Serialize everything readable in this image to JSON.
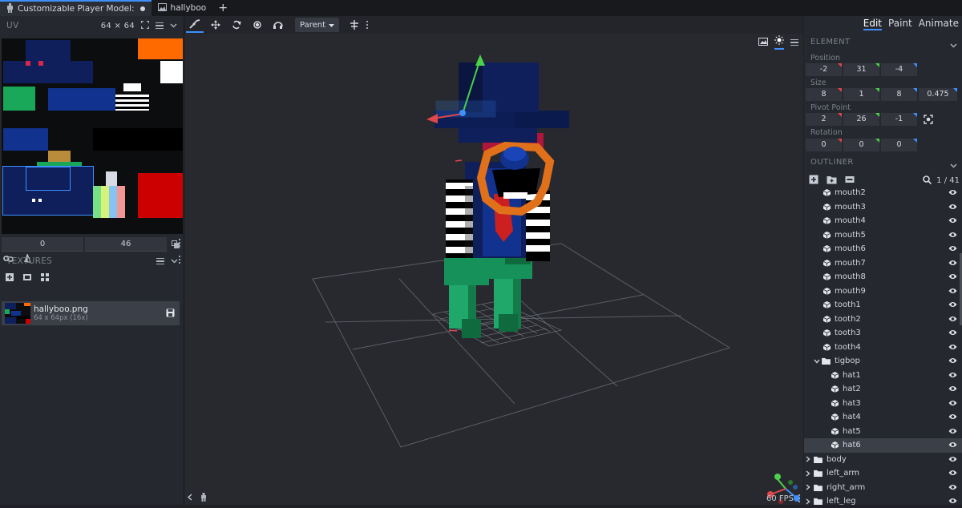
{
  "tabs": [
    {
      "label": "Customizable Player Model:",
      "active": true,
      "unsaved": true
    },
    {
      "label": "hallyboo",
      "active": false
    }
  ],
  "uv": {
    "title": "UV",
    "resolution": "64 ⨯ 64",
    "input_x": "0",
    "input_y": "46"
  },
  "textures": {
    "title": "TEXTURES",
    "item_name": "hallyboo.png",
    "item_size": "64 x 64px (16x)"
  },
  "toolbar": {
    "pivot_select": "Parent"
  },
  "modes": {
    "edit": "Edit",
    "paint": "Paint",
    "animate": "Animate"
  },
  "element": {
    "title": "ELEMENT",
    "position_label": "Position",
    "position": [
      "-2",
      "31",
      "-4"
    ],
    "size_label": "Size",
    "size": [
      "8",
      "1",
      "8",
      "0.475"
    ],
    "pivot_label": "Pivot Point",
    "pivot": [
      "2",
      "26",
      "-1"
    ],
    "rotation_label": "Rotation",
    "rotation": [
      "0",
      "0",
      "0"
    ]
  },
  "outliner": {
    "title": "OUTLINER",
    "count": "1 / 41",
    "rows": [
      {
        "label": "mouth2",
        "type": "cube",
        "indent": 1
      },
      {
        "label": "mouth3",
        "type": "cube",
        "indent": 1
      },
      {
        "label": "mouth4",
        "type": "cube",
        "indent": 1
      },
      {
        "label": "mouth5",
        "type": "cube",
        "indent": 1
      },
      {
        "label": "mouth6",
        "type": "cube",
        "indent": 1
      },
      {
        "label": "mouth7",
        "type": "cube",
        "indent": 1
      },
      {
        "label": "mouth8",
        "type": "cube",
        "indent": 1
      },
      {
        "label": "mouth9",
        "type": "cube",
        "indent": 1
      },
      {
        "label": "tooth1",
        "type": "cube",
        "indent": 1
      },
      {
        "label": "tooth2",
        "type": "cube",
        "indent": 1
      },
      {
        "label": "tooth3",
        "type": "cube",
        "indent": 1
      },
      {
        "label": "tooth4",
        "type": "cube",
        "indent": 1
      },
      {
        "label": "tigbop",
        "type": "folder",
        "indent": 1,
        "expanded": true
      },
      {
        "label": "hat1",
        "type": "cube",
        "indent": 2
      },
      {
        "label": "hat2",
        "type": "cube",
        "indent": 2
      },
      {
        "label": "hat3",
        "type": "cube",
        "indent": 2
      },
      {
        "label": "hat4",
        "type": "cube",
        "indent": 2
      },
      {
        "label": "hat5",
        "type": "cube",
        "indent": 2
      },
      {
        "label": "hat6",
        "type": "cube",
        "indent": 2,
        "selected": true
      },
      {
        "label": "body",
        "type": "folder",
        "indent": 0
      },
      {
        "label": "left_arm",
        "type": "folder",
        "indent": 0
      },
      {
        "label": "right_arm",
        "type": "folder",
        "indent": 0
      },
      {
        "label": "left_leg",
        "type": "folder",
        "indent": 0
      }
    ]
  },
  "status": {
    "fps": "60 FPS"
  },
  "colors": {
    "accent": "#3e90ff",
    "axis_x": "#e0474c",
    "axis_y": "#4bd14b",
    "axis_z": "#3e90ff"
  }
}
